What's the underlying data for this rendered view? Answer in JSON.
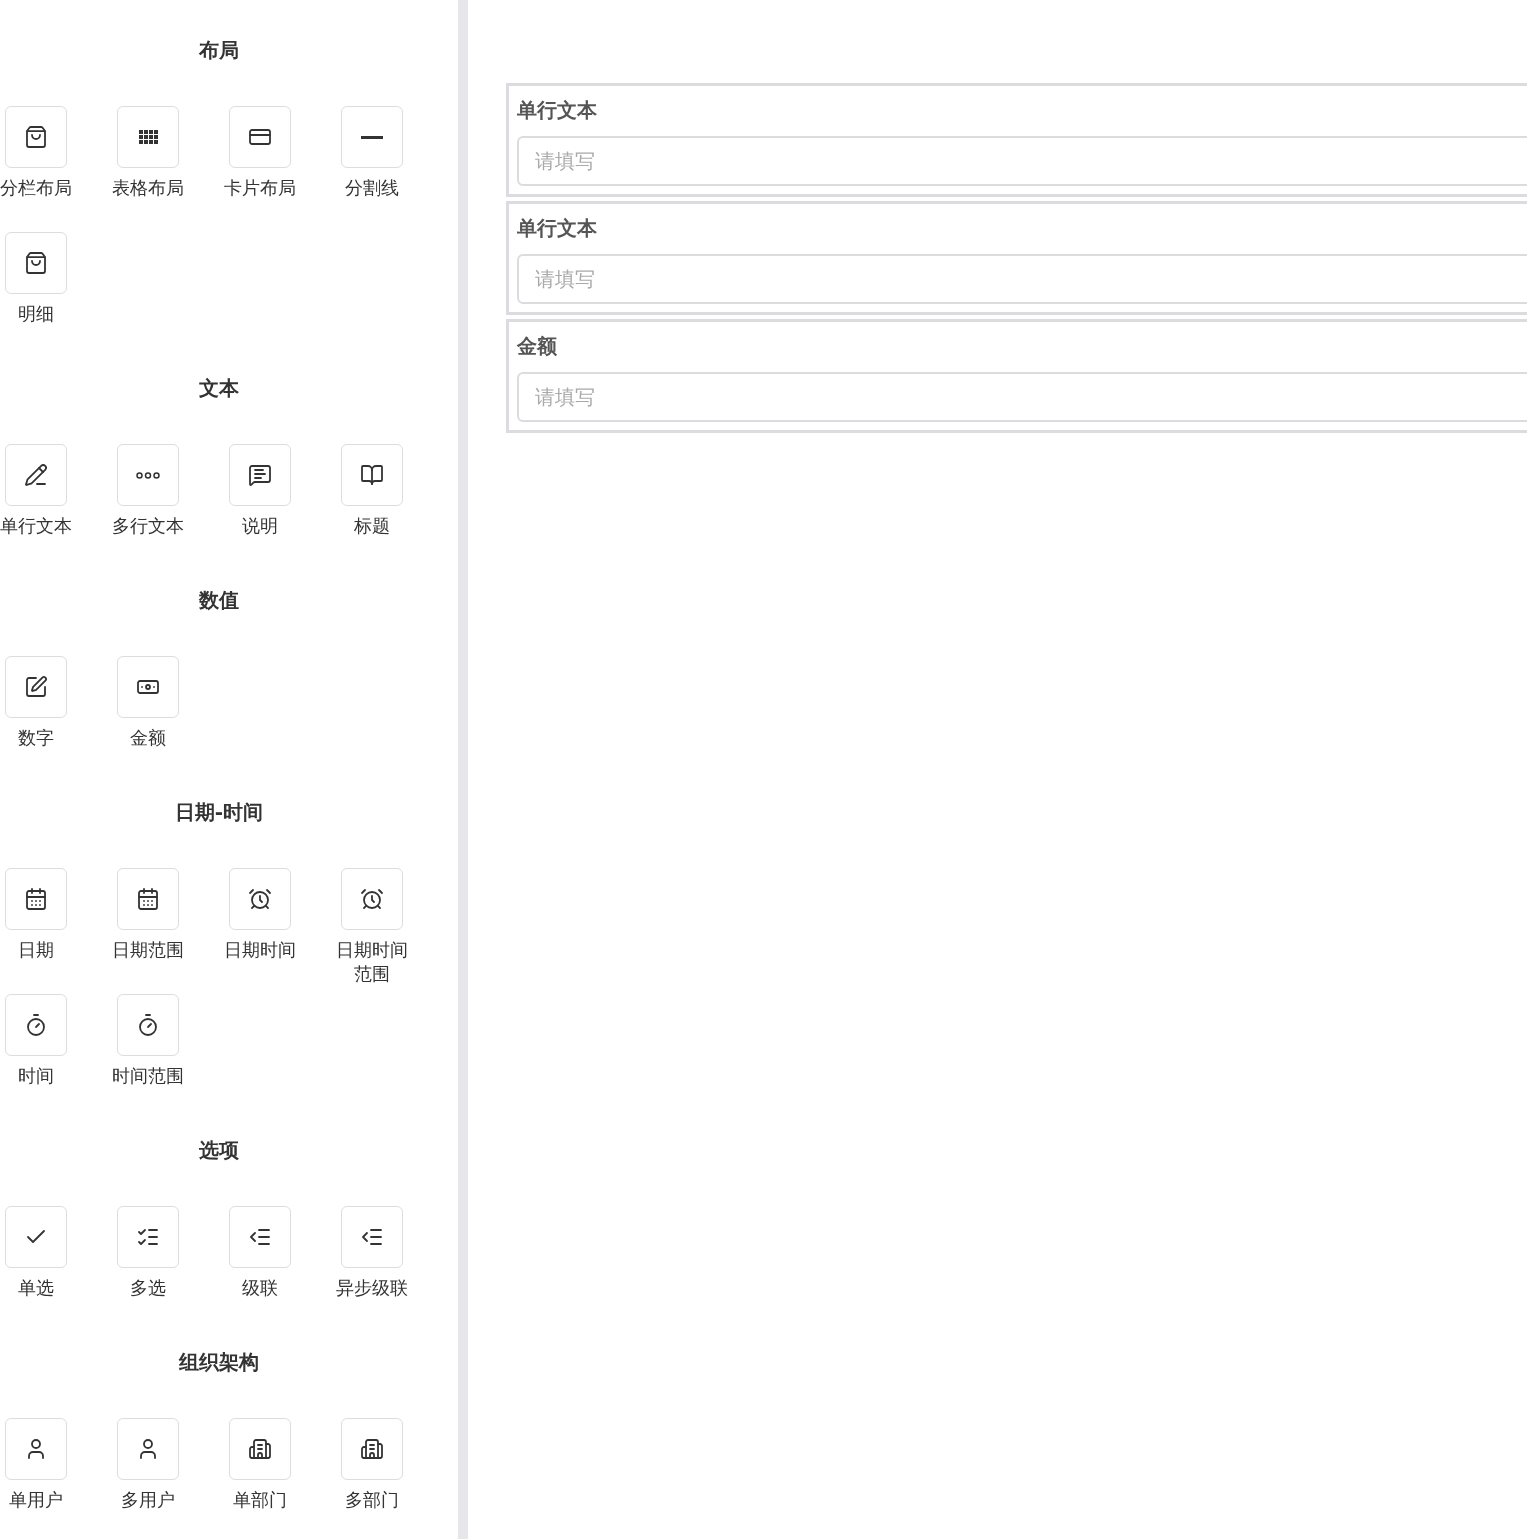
{
  "palette": {
    "sections": [
      {
        "title": "布局",
        "items": [
          {
            "label": "分栏布局"
          },
          {
            "label": "表格布局"
          },
          {
            "label": "卡片布局"
          },
          {
            "label": "分割线"
          },
          {
            "label": "明细"
          }
        ]
      },
      {
        "title": "文本",
        "items": [
          {
            "label": "单行文本"
          },
          {
            "label": "多行文本"
          },
          {
            "label": "说明"
          },
          {
            "label": "标题"
          }
        ]
      },
      {
        "title": "数值",
        "items": [
          {
            "label": "数字"
          },
          {
            "label": "金额"
          }
        ]
      },
      {
        "title": "日期-时间",
        "items": [
          {
            "label": "日期"
          },
          {
            "label": "日期范围"
          },
          {
            "label": "日期时间"
          },
          {
            "label": "日期时间范围"
          },
          {
            "label": "时间"
          },
          {
            "label": "时间范围"
          }
        ]
      },
      {
        "title": "选项",
        "items": [
          {
            "label": "单选"
          },
          {
            "label": "多选"
          },
          {
            "label": "级联"
          },
          {
            "label": "异步级联"
          }
        ]
      },
      {
        "title": "组织架构",
        "items": [
          {
            "label": "单用户"
          },
          {
            "label": "多用户"
          },
          {
            "label": "单部门"
          },
          {
            "label": "多部门"
          }
        ]
      }
    ]
  },
  "form": {
    "fields": [
      {
        "label": "单行文本",
        "placeholder": "请填写"
      },
      {
        "label": "单行文本",
        "placeholder": "请填写"
      },
      {
        "label": "金额",
        "placeholder": "请填写"
      }
    ]
  }
}
